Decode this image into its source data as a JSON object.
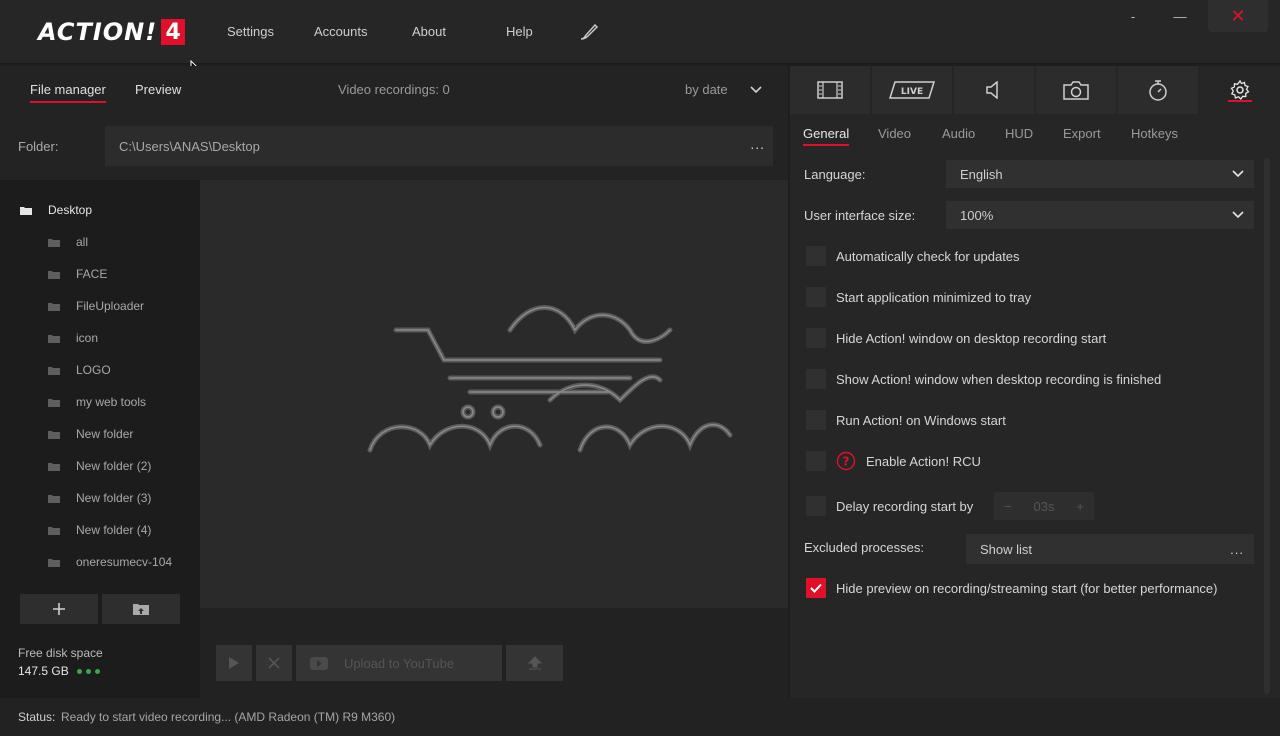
{
  "app": {
    "logo_text": "ACTION!",
    "logo_version": "4",
    "nav": {
      "settings": "Settings",
      "accounts": "Accounts",
      "about": "About",
      "help": "Help"
    },
    "window": {
      "minimize_alt": "-",
      "minimize": "—",
      "close": "✕"
    }
  },
  "left": {
    "tabs": {
      "file_manager": "File manager",
      "preview": "Preview"
    },
    "video_count": "Video recordings: 0",
    "sort": "by date",
    "folder_label": "Folder:",
    "folder_path": "C:\\Users\\ANAS\\Desktop",
    "folder_more": "...",
    "tree": {
      "root": "Desktop",
      "items": [
        "all",
        "FACE",
        "FileUploader",
        "icon",
        "LOGO",
        "my web tools",
        "New folder",
        "New folder (2)",
        "New folder (3)",
        "New folder (4)",
        "oneresumecv-104"
      ]
    },
    "disk": {
      "label": "Free disk space",
      "value": "147.5 GB"
    },
    "controls": {
      "upload": "Upload to YouTube"
    }
  },
  "right": {
    "subtabs": {
      "general": "General",
      "video": "Video",
      "audio": "Audio",
      "hud": "HUD",
      "export": "Export",
      "hotkeys": "Hotkeys"
    },
    "live_label": "LIVE",
    "language": {
      "label": "Language:",
      "value": "English"
    },
    "ui_size": {
      "label": "User interface size:",
      "value": "100%"
    },
    "options": {
      "auto_update": "Automatically check for updates",
      "minimized": "Start application minimized to tray",
      "hide_on_start": "Hide Action! window on desktop recording start",
      "show_on_finish": "Show Action! window when desktop recording is finished",
      "run_on_start": "Run Action! on Windows start",
      "rcu": "Enable Action! RCU",
      "delay": "Delay recording start by",
      "hide_preview": "Hide preview on recording/streaming start (for better performance)"
    },
    "delay_value": "03s",
    "delay_minus": "−",
    "delay_plus": "+",
    "excluded": {
      "label": "Excluded processes:",
      "button": "Show list",
      "more": "..."
    }
  },
  "status": {
    "label": "Status:",
    "text": "Ready to start video recording... (AMD Radeon (TM) R9 M360)"
  },
  "colors": {
    "accent": "#e0102b",
    "disk_ok": "#3aa84a"
  }
}
